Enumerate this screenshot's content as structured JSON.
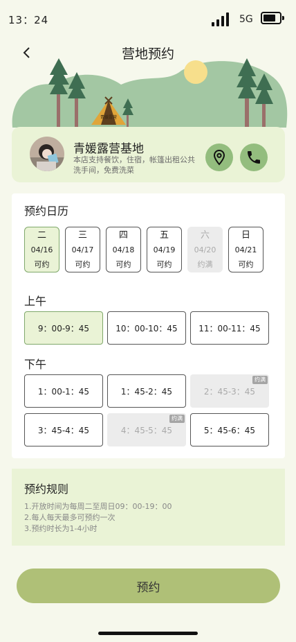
{
  "status": {
    "time": "13：24",
    "network": "5G"
  },
  "header": {
    "title": "营地预约"
  },
  "camp": {
    "sign": "青媛露营",
    "name": "青媛露营基地",
    "desc": "本店支持餐饮，住宿，帐篷出租公共洗手间，免费洗菜"
  },
  "calendar": {
    "title": "预约日历",
    "days": [
      {
        "weekday": "二",
        "date": "04/16",
        "status": "可约"
      },
      {
        "weekday": "三",
        "date": "04/17",
        "status": "可约"
      },
      {
        "weekday": "四",
        "date": "04/18",
        "status": "可约"
      },
      {
        "weekday": "五",
        "date": "04/19",
        "status": "可约"
      },
      {
        "weekday": "六",
        "date": "04/20",
        "status": "约满"
      },
      {
        "weekday": "日",
        "date": "04/21",
        "status": "可约"
      }
    ]
  },
  "morning": {
    "title": "上午",
    "slots": [
      "9：00-9：45",
      "10：00-10：45",
      "11：00-11：45"
    ]
  },
  "afternoon": {
    "title": "下午",
    "slots": [
      "1：00-1：45",
      "1：45-2：45",
      "2：45-3：45",
      "3：45-4：45",
      "4：45-5：45",
      "5：45-6：45"
    ]
  },
  "full_tag": "约满",
  "rules": {
    "title": "预约规则",
    "lines": [
      "1.开放时间为每周二至周日09：00-19：00",
      "2.每人每天最多可预约一次",
      "3.预约时长为1-4小时"
    ]
  },
  "submit_label": "预约",
  "colors": {
    "accent": "#93bd7e",
    "card_bg": "#eaf3d6",
    "button": "#afc077",
    "page_bg": "#f6f8ec"
  }
}
